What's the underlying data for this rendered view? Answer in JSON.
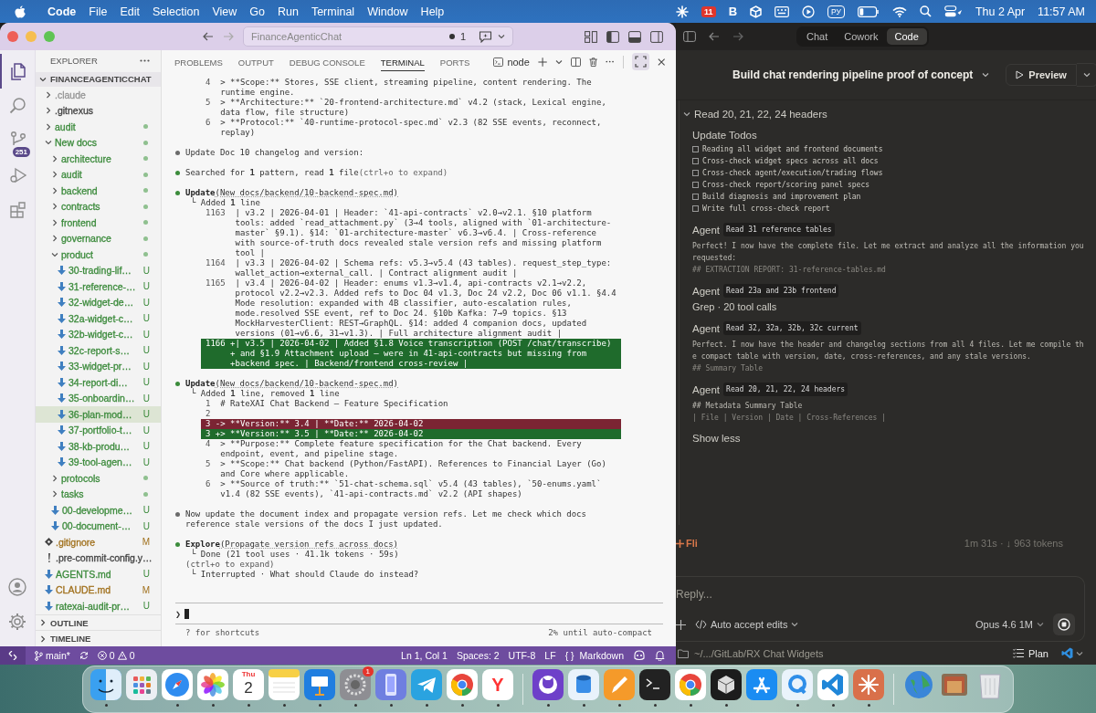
{
  "menubar": {
    "app": "Code",
    "menus": [
      "File",
      "Edit",
      "Selection",
      "View",
      "Go",
      "Run",
      "Terminal",
      "Window",
      "Help"
    ],
    "status_items": [
      {
        "kind": "burst"
      },
      {
        "kind": "badge",
        "text": "11"
      },
      {
        "kind": "letter",
        "text": "B"
      },
      {
        "kind": "cube"
      },
      {
        "kind": "keyboard"
      },
      {
        "kind": "play"
      },
      {
        "kind": "input",
        "text": "РУ"
      },
      {
        "kind": "battery"
      },
      {
        "kind": "wifi"
      },
      {
        "kind": "search"
      },
      {
        "kind": "control"
      }
    ],
    "date": "Thu 2 Apr",
    "time": "11:57 AM"
  },
  "vscode": {
    "title_bar": {
      "search": "FinanceAgenticChat",
      "changes": "1"
    },
    "activity_bar": [
      {
        "kind": "files",
        "selected": true
      },
      {
        "kind": "search",
        "selected": false
      },
      {
        "kind": "source-control",
        "selected": false,
        "badge": "251"
      },
      {
        "kind": "run",
        "selected": false
      },
      {
        "kind": "extensions",
        "selected": false
      }
    ],
    "explorer": {
      "title": "EXPLORER",
      "root": "FINANCEAGENTICCHAT",
      "root_expanded": true,
      "tree": [
        {
          "name": ".claude",
          "kind": "folder",
          "expanded": false,
          "color": "#949494",
          "has_changes": false,
          "selected": false
        },
        {
          "name": ".gitnexus",
          "kind": "folder",
          "expanded": false,
          "color": "#3f3f3f",
          "has_changes": false,
          "selected": false
        },
        {
          "name": "audit",
          "kind": "folder",
          "expanded": false,
          "color": "#3b8a3b",
          "has_changes": true,
          "selected": false
        },
        {
          "name": "New docs",
          "kind": "folder",
          "expanded": true,
          "color": "#3b8a3b",
          "has_changes": true,
          "selected": false,
          "children": [
            {
              "name": "architecture",
              "kind": "folder",
              "expanded": false,
              "color": "#3b8a3b",
              "has_changes": true,
              "selected": false
            },
            {
              "name": "audit",
              "kind": "folder",
              "expanded": false,
              "color": "#3b8a3b",
              "has_changes": true,
              "selected": false
            },
            {
              "name": "backend",
              "kind": "folder",
              "expanded": false,
              "color": "#3b8a3b",
              "has_changes": true,
              "selected": false
            },
            {
              "name": "contracts",
              "kind": "folder",
              "expanded": false,
              "color": "#3b8a3b",
              "has_changes": true,
              "selected": false
            },
            {
              "name": "frontend",
              "kind": "folder",
              "expanded": false,
              "color": "#3b8a3b",
              "has_changes": true,
              "selected": false
            },
            {
              "name": "governance",
              "kind": "folder",
              "expanded": false,
              "color": "#3b8a3b",
              "has_changes": true,
              "selected": false
            },
            {
              "name": "product",
              "kind": "folder",
              "expanded": true,
              "color": "#3b8a3b",
              "has_changes": true,
              "selected": false,
              "children": [
                {
                  "name": "30-trading-lif…",
                  "kind": "markdown",
                  "color": "#3b8a3b",
                  "badge": "U",
                  "selected": false
                },
                {
                  "name": "31-reference-…",
                  "kind": "markdown",
                  "color": "#3b8a3b",
                  "badge": "U",
                  "selected": false
                },
                {
                  "name": "32-widget-de…",
                  "kind": "markdown",
                  "color": "#3b8a3b",
                  "badge": "U",
                  "selected": false
                },
                {
                  "name": "32a-widget-c…",
                  "kind": "markdown",
                  "color": "#3b8a3b",
                  "badge": "U",
                  "selected": false
                },
                {
                  "name": "32b-widget-c…",
                  "kind": "markdown",
                  "color": "#3b8a3b",
                  "badge": "U",
                  "selected": false
                },
                {
                  "name": "32c-report-s…",
                  "kind": "markdown",
                  "color": "#3b8a3b",
                  "badge": "U",
                  "selected": false
                },
                {
                  "name": "33-widget-pr…",
                  "kind": "markdown",
                  "color": "#3b8a3b",
                  "badge": "U",
                  "selected": false
                },
                {
                  "name": "34-report-di…",
                  "kind": "markdown",
                  "color": "#3b8a3b",
                  "badge": "U",
                  "selected": false
                },
                {
                  "name": "35-onboardin…",
                  "kind": "markdown",
                  "color": "#3b8a3b",
                  "badge": "U",
                  "selected": false
                },
                {
                  "name": "36-plan-mod…",
                  "kind": "markdown",
                  "color": "#3b8a3b",
                  "badge": "U",
                  "selected": true
                },
                {
                  "name": "37-portfolio-t…",
                  "kind": "markdown",
                  "color": "#3b8a3b",
                  "badge": "U",
                  "selected": false
                },
                {
                  "name": "38-kb-produ…",
                  "kind": "markdown",
                  "color": "#3b8a3b",
                  "badge": "U",
                  "selected": false
                },
                {
                  "name": "39-tool-agen…",
                  "kind": "markdown",
                  "color": "#3b8a3b",
                  "badge": "U",
                  "selected": false
                }
              ]
            },
            {
              "name": "protocols",
              "kind": "folder",
              "expanded": false,
              "color": "#3b8a3b",
              "has_changes": true,
              "selected": false
            },
            {
              "name": "tasks",
              "kind": "folder",
              "expanded": false,
              "color": "#3b8a3b",
              "has_changes": true,
              "selected": false
            },
            {
              "name": "00-developme…",
              "kind": "markdown",
              "color": "#3b8a3b",
              "badge": "U",
              "selected": false
            },
            {
              "name": "00-document-…",
              "kind": "markdown",
              "color": "#3b8a3b",
              "badge": "U",
              "selected": false
            }
          ]
        },
        {
          "name": ".gitignore",
          "kind": "gitignore",
          "color": "#a0701c",
          "badge": "M",
          "selected": false
        },
        {
          "name": ".pre-commit-config.y…",
          "kind": "yaml",
          "color": "#3f3f3f",
          "selected": false
        },
        {
          "name": "AGENTS.md",
          "kind": "markdown",
          "color": "#3b8a3b",
          "badge": "U",
          "selected": false
        },
        {
          "name": "CLAUDE.md",
          "kind": "markdown",
          "color": "#a0701c",
          "badge": "M",
          "selected": false
        },
        {
          "name": "ratexai-audit-pr…",
          "kind": "markdown",
          "color": "#3b8a3b",
          "badge": "U",
          "selected": false
        }
      ],
      "sections": [
        {
          "label": "OUTLINE",
          "expanded": false
        },
        {
          "label": "TIMELINE",
          "expanded": false
        }
      ]
    },
    "panel": {
      "tabs": [
        {
          "label": "PROBLEMS",
          "selected": false
        },
        {
          "label": "OUTPUT",
          "selected": false
        },
        {
          "label": "DEBUG CONSOLE",
          "selected": false
        },
        {
          "label": "TERMINAL",
          "selected": true
        },
        {
          "label": "PORTS",
          "selected": false
        }
      ],
      "terminal_name": "node",
      "transcript": [
        {
          "kind": "listing",
          "rows": [
            {
              "kind": "context",
              "num": "4",
              "text": "> **Scope:** Stores, SSE client, streaming pipeline, content rendering. The runtime engine."
            },
            {
              "kind": "context",
              "num": "5",
              "text": "> **Architecture:** `20-frontend-architecture.md` v4.2 (stack, Lexical engine, data flow, file structure)"
            },
            {
              "kind": "context",
              "num": "6",
              "text": "> **Protocol:** `40-runtime-protocol-spec.md` v2.3 (82 SSE events, reconnect, replay)"
            }
          ]
        },
        {
          "kind": "bullet",
          "color": "#6b6b6b",
          "text": "Update Doc 10 changelog and version:"
        },
        {
          "kind": "bullet",
          "color": "#3c8c3c",
          "text": "Searched for **1** pattern, read **1** file",
          "hint": "(ctrl+o to expand)"
        },
        {
          "kind": "tool",
          "color": "#3c8c3c",
          "name": "Update",
          "arg": "(New docs/backend/10-backend-spec.md)"
        },
        {
          "kind": "result",
          "marker": "└",
          "text": "Added **1** line"
        },
        {
          "kind": "listing",
          "rows": [
            {
              "kind": "context",
              "num": "1163",
              "text": "| v3.2 | 2026-04-01 | Header: `41-api-contracts` v2.0→v2.1. §10 platform tools: added `read_attachment.py` (3→4 tools, aligned with `01-architecture-master` §9.1). §14: `01-architecture-master` v6.3→v6.4. | Cross-reference with source-of-truth docs revealed stale version refs and missing platform tool |"
            },
            {
              "kind": "context",
              "num": "1164",
              "text": "| v3.3 | 2026-04-02 | Schema refs: v5.3→v5.4 (43 tables). request_step_type: wallet_action→external_call. | Contract alignment audit |"
            },
            {
              "kind": "context",
              "num": "1165",
              "text": "| v3.4 | 2026-04-02 | Header: enums v1.3→v1.4, api-contracts v2.1→v2.2, protocol v2.2→v2.3. Added refs to Doc 04 v1.3, Doc 24 v2.2, Doc 06 v1.1. §4.4 Mode resolution: expanded with 4B classifier, auto-escalation rules, mode.resolved SSE event, ref to Doc 24. §10b Kafka: 7→9 topics. §13 MockHarvesterClient: REST→GraphQL. §14: added 4 companion docs, updated versions (01→v6.6, 31→v1.3). | Full architecture alignment audit |"
            },
            {
              "kind": "added",
              "num": "1166",
              "lines": [
                "+| v3.5 | 2026-04-02 | Added §1.8 Voice transcription (POST /chat/transcribe)",
                "+ and §1.9 Attachment upload — were in 41-api-contracts but missing from",
                "+backend spec. | Backend/frontend cross-review |"
              ]
            }
          ]
        },
        {
          "kind": "tool",
          "color": "#3c8c3c",
          "name": "Update",
          "arg": "(New docs/backend/10-backend-spec.md)"
        },
        {
          "kind": "result",
          "marker": "└",
          "text": "Added **1** line, removed **1** line"
        },
        {
          "kind": "listing",
          "rows": [
            {
              "kind": "context",
              "num": "1",
              "text": "# RateXAI Chat Backend — Feature Specification"
            },
            {
              "kind": "context",
              "num": "2"
            },
            {
              "kind": "removed",
              "num": "3",
              "lines": [
                "-> **Version:** 3.4 | **Date:** 2026-04-02"
              ]
            },
            {
              "kind": "added",
              "num": "3",
              "lines": [
                "+> **Version:** 3.5 | **Date:** 2026-04-02"
              ]
            },
            {
              "kind": "context",
              "num": "4",
              "text": "> **Purpose:** Complete feature specification for the Chat backend. Every endpoint, event, and pipeline stage."
            },
            {
              "kind": "context",
              "num": "5",
              "text": "> **Scope:** Chat backend (Python/FastAPI). References to Financial Layer (Go) and Core where applicable."
            },
            {
              "kind": "context",
              "num": "6",
              "text": "> **Source of truth:** `51-chat-schema.sql` v5.4 (43 tables), `50-enums.yaml` v1.4 (82 SSE events), `41-api-contracts.md` v2.2 (API shapes)"
            }
          ]
        },
        {
          "kind": "bullet",
          "color": "#6b6b6b",
          "text": "Now update the document index and propagate version refs. Let me check which docs reference stale versions of the docs I just updated."
        },
        {
          "kind": "tool",
          "color": "#3c8c3c",
          "name": "Explore",
          "arg": "(Propagate version refs across docs)"
        },
        {
          "kind": "result",
          "marker": "└",
          "text": "Done (21 tool uses · 41.1k tokens · 59s)"
        },
        {
          "kind": "note",
          "text": "(ctrl+o to expand)"
        },
        {
          "kind": "result",
          "marker": "└",
          "text": "Interrupted · What should Claude do instead?"
        }
      ],
      "prompt": "❯",
      "footer_left": "? for shortcuts",
      "footer_right": "2% until auto-compact"
    },
    "status_bar": {
      "branch": "main*",
      "errors": "0",
      "warnings": "0",
      "items": [
        "Ln 1, Col 1",
        "Spaces: 2",
        "UTF-8",
        "LF"
      ],
      "language_icon": "{ }",
      "language": "Markdown"
    }
  },
  "claude": {
    "tabs": [
      {
        "label": "Chat",
        "selected": false
      },
      {
        "label": "Cowork",
        "selected": false
      },
      {
        "label": "Code",
        "selected": true
      }
    ],
    "title": "Build chat rendering pipeline proof of concept",
    "preview": "Preview",
    "group": {
      "label": "Read 20, 21, 22, 24 headers",
      "expanded": true
    },
    "entries": [
      {
        "kind": "todos",
        "title": "Update Todos",
        "items": [
          {
            "text": "Reading all widget and frontend documents",
            "checked": false
          },
          {
            "text": "Cross-check widget specs across all docs",
            "checked": false
          },
          {
            "text": "Cross-check agent/execution/trading flows",
            "checked": false
          },
          {
            "text": "Cross-check report/scoring panel specs",
            "checked": false
          },
          {
            "text": "Build diagnosis and improvement plan",
            "checked": false
          },
          {
            "text": "Write full cross-check report",
            "checked": false
          }
        ]
      },
      {
        "kind": "agent",
        "label": "Agent",
        "task": "Read 31 reference tables",
        "body": [
          {
            "kind": "mono",
            "text": "Perfect! I now have the complete file. Let me extract and analyze all the information you requested:"
          },
          {
            "kind": "faded",
            "text": "## EXTRACTION REPORT: 31-reference-tables.md"
          }
        ]
      },
      {
        "kind": "agent",
        "label": "Agent",
        "task": "Read 23a and 23b frontend",
        "body": [
          {
            "kind": "sans",
            "text": "Grep · 20 tool calls"
          }
        ]
      },
      {
        "kind": "agent",
        "label": "Agent",
        "task": "Read 32, 32a, 32b, 32c current",
        "body": [
          {
            "kind": "mono",
            "text": "Perfect. I now have the header and changelog sections from all 4 files. Let me compile the compact table with version, date, cross-references, and any stale versions."
          },
          {
            "kind": "faded",
            "text": "## Summary Table"
          }
        ]
      },
      {
        "kind": "agent",
        "label": "Agent",
        "task": "Read 20, 21, 22, 24 headers",
        "body": [
          {
            "kind": "mono",
            "text": "## Metadata Summary Table"
          },
          {
            "kind": "dim",
            "text": "| File | Version | Date | Cross-References |"
          }
        ]
      }
    ],
    "show_less": "Show less",
    "activity": {
      "text": "Fli",
      "stats": "1m 31s · ↓ 963 tokens"
    },
    "composer": {
      "placeholder": "Reply...",
      "mode": "Auto accept edits",
      "model": "Opus 4.6 1M"
    },
    "footer": {
      "path": "~/.../GitLab/RX Chat Widgets",
      "plan": "Plan"
    }
  },
  "dock": [
    {
      "kind": "finder",
      "running": true
    },
    {
      "kind": "launchpad",
      "running": false
    },
    {
      "kind": "safari",
      "running": true
    },
    {
      "kind": "photos",
      "running": true
    },
    {
      "kind": "calendar",
      "running": true,
      "day": "Thu",
      "date": "2"
    },
    {
      "kind": "notes",
      "running": true
    },
    {
      "kind": "keynote",
      "running": true
    },
    {
      "kind": "settings",
      "running": true,
      "badge": "1"
    },
    {
      "kind": "simulator",
      "running": true
    },
    {
      "kind": "telegram",
      "running": true
    },
    {
      "kind": "chrome",
      "running": true
    },
    {
      "kind": "yandex",
      "running": true,
      "label": "Y"
    },
    {
      "kind": "separator"
    },
    {
      "kind": "github",
      "running": true
    },
    {
      "kind": "cylinder",
      "running": true
    },
    {
      "kind": "pencil",
      "running": true
    },
    {
      "kind": "terminal",
      "running": true
    },
    {
      "kind": "chrome",
      "running": true
    },
    {
      "kind": "cube",
      "running": true
    },
    {
      "kind": "appstore",
      "running": false
    },
    {
      "kind": "qring",
      "running": true
    },
    {
      "kind": "vscode",
      "running": true
    },
    {
      "kind": "burst",
      "running": true
    },
    {
      "kind": "separator"
    },
    {
      "kind": "globe",
      "running": false
    },
    {
      "kind": "imagestack",
      "running": false
    },
    {
      "kind": "trash",
      "running": false
    }
  ]
}
